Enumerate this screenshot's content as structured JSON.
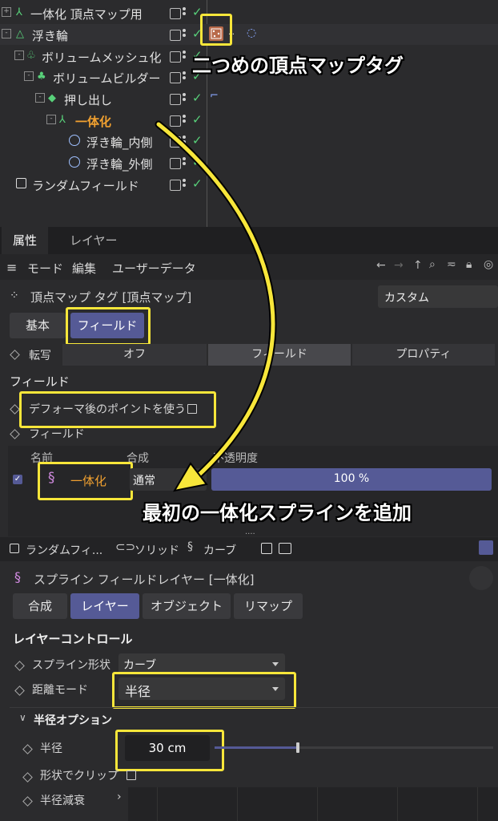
{
  "object_manager": {
    "rows": [
      {
        "label": "一体化 頂点マップ用"
      },
      {
        "label": "浮き輪"
      },
      {
        "label": "ボリュームメッシュ化"
      },
      {
        "label": "ボリュームビルダー"
      },
      {
        "label": "押し出し"
      },
      {
        "label": "一体化"
      },
      {
        "label": "浮き輪_内側"
      },
      {
        "label": "浮き輪_外側"
      },
      {
        "label": "ランダムフィールド"
      }
    ]
  },
  "tabs": [
    "属性",
    "レイヤー"
  ],
  "menubar": {
    "mode": "モード",
    "edit": "編集",
    "userdata": "ユーザーデータ"
  },
  "attr": {
    "title": "頂点マップ タグ [頂点マップ]",
    "preset": "カスタム",
    "tab_basic": "基本",
    "tab_field": "フィールド",
    "transfer_label": "転写",
    "transfer_options": [
      "オフ",
      "フィールド",
      "プロパティ"
    ],
    "section_field": "フィールド",
    "use_deformed_points": "デフォーマ後のポイントを使う",
    "field_label": "フィールド",
    "list_headers": {
      "name": "名前",
      "blend": "合成",
      "opacity": "不透明度"
    },
    "field_item": {
      "name": "一体化",
      "blend": "通常",
      "opacity_text": "100 %",
      "opacity": 1.0
    },
    "dots": "....",
    "layer_tabs": [
      "ランダムフィ...",
      "ソリッド",
      "カーブ"
    ]
  },
  "layer": {
    "title": "スプライン フィールドレイヤー [一体化]",
    "tabs": [
      "合成",
      "レイヤー",
      "オブジェクト",
      "リマップ"
    ],
    "controls_title": "レイヤーコントロール",
    "spline_shape_label": "スプライン形状",
    "spline_shape_value": "カーブ",
    "distance_mode_label": "距離モード",
    "distance_mode_value": "半径",
    "radius_options_title": "半径オプション",
    "radius_label": "半径",
    "radius_value": "30 cm",
    "radius_slider": 0.3,
    "clip_label": "形状でクリップ",
    "falloff_label": "半径減衰"
  },
  "annotations": {
    "top": "二つめの頂点マップタグ",
    "bottom": "最初の一体化スプラインを追加"
  },
  "colors": {
    "highlight": "#f7e63a",
    "accent": "#555a96",
    "check": "#58d17a",
    "orange": "#f0a030"
  }
}
